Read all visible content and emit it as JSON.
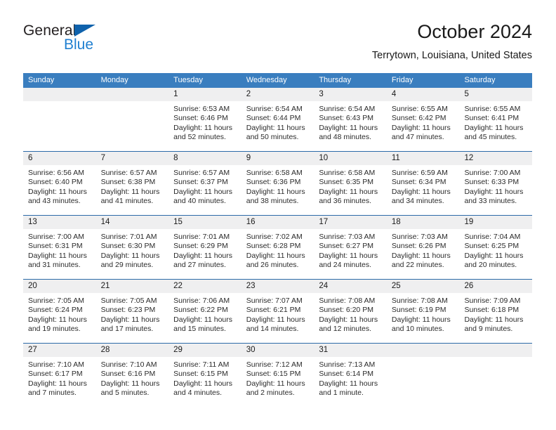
{
  "brand": {
    "name_dark": "General",
    "name_blue": "Blue",
    "accent_blue": "#1f7fd0",
    "triangle_blue": "#0f62ac"
  },
  "header": {
    "title": "October 2024",
    "subtitle": "Terrytown, Louisiana, United States"
  },
  "theme": {
    "header_row_blue": "#3a7ebf",
    "week_separator_blue": "#2c6aa8",
    "day_number_band": "#efeff0"
  },
  "weekday_headers": [
    "Sunday",
    "Monday",
    "Tuesday",
    "Wednesday",
    "Thursday",
    "Friday",
    "Saturday"
  ],
  "weeks": [
    [
      {
        "day": "",
        "sunrise": "",
        "sunset": "",
        "daylight1": "",
        "daylight2": ""
      },
      {
        "day": "",
        "sunrise": "",
        "sunset": "",
        "daylight1": "",
        "daylight2": ""
      },
      {
        "day": "1",
        "sunrise": "Sunrise: 6:53 AM",
        "sunset": "Sunset: 6:46 PM",
        "daylight1": "Daylight: 11 hours",
        "daylight2": "and 52 minutes."
      },
      {
        "day": "2",
        "sunrise": "Sunrise: 6:54 AM",
        "sunset": "Sunset: 6:44 PM",
        "daylight1": "Daylight: 11 hours",
        "daylight2": "and 50 minutes."
      },
      {
        "day": "3",
        "sunrise": "Sunrise: 6:54 AM",
        "sunset": "Sunset: 6:43 PM",
        "daylight1": "Daylight: 11 hours",
        "daylight2": "and 48 minutes."
      },
      {
        "day": "4",
        "sunrise": "Sunrise: 6:55 AM",
        "sunset": "Sunset: 6:42 PM",
        "daylight1": "Daylight: 11 hours",
        "daylight2": "and 47 minutes."
      },
      {
        "day": "5",
        "sunrise": "Sunrise: 6:55 AM",
        "sunset": "Sunset: 6:41 PM",
        "daylight1": "Daylight: 11 hours",
        "daylight2": "and 45 minutes."
      }
    ],
    [
      {
        "day": "6",
        "sunrise": "Sunrise: 6:56 AM",
        "sunset": "Sunset: 6:40 PM",
        "daylight1": "Daylight: 11 hours",
        "daylight2": "and 43 minutes."
      },
      {
        "day": "7",
        "sunrise": "Sunrise: 6:57 AM",
        "sunset": "Sunset: 6:38 PM",
        "daylight1": "Daylight: 11 hours",
        "daylight2": "and 41 minutes."
      },
      {
        "day": "8",
        "sunrise": "Sunrise: 6:57 AM",
        "sunset": "Sunset: 6:37 PM",
        "daylight1": "Daylight: 11 hours",
        "daylight2": "and 40 minutes."
      },
      {
        "day": "9",
        "sunrise": "Sunrise: 6:58 AM",
        "sunset": "Sunset: 6:36 PM",
        "daylight1": "Daylight: 11 hours",
        "daylight2": "and 38 minutes."
      },
      {
        "day": "10",
        "sunrise": "Sunrise: 6:58 AM",
        "sunset": "Sunset: 6:35 PM",
        "daylight1": "Daylight: 11 hours",
        "daylight2": "and 36 minutes."
      },
      {
        "day": "11",
        "sunrise": "Sunrise: 6:59 AM",
        "sunset": "Sunset: 6:34 PM",
        "daylight1": "Daylight: 11 hours",
        "daylight2": "and 34 minutes."
      },
      {
        "day": "12",
        "sunrise": "Sunrise: 7:00 AM",
        "sunset": "Sunset: 6:33 PM",
        "daylight1": "Daylight: 11 hours",
        "daylight2": "and 33 minutes."
      }
    ],
    [
      {
        "day": "13",
        "sunrise": "Sunrise: 7:00 AM",
        "sunset": "Sunset: 6:31 PM",
        "daylight1": "Daylight: 11 hours",
        "daylight2": "and 31 minutes."
      },
      {
        "day": "14",
        "sunrise": "Sunrise: 7:01 AM",
        "sunset": "Sunset: 6:30 PM",
        "daylight1": "Daylight: 11 hours",
        "daylight2": "and 29 minutes."
      },
      {
        "day": "15",
        "sunrise": "Sunrise: 7:01 AM",
        "sunset": "Sunset: 6:29 PM",
        "daylight1": "Daylight: 11 hours",
        "daylight2": "and 27 minutes."
      },
      {
        "day": "16",
        "sunrise": "Sunrise: 7:02 AM",
        "sunset": "Sunset: 6:28 PM",
        "daylight1": "Daylight: 11 hours",
        "daylight2": "and 26 minutes."
      },
      {
        "day": "17",
        "sunrise": "Sunrise: 7:03 AM",
        "sunset": "Sunset: 6:27 PM",
        "daylight1": "Daylight: 11 hours",
        "daylight2": "and 24 minutes."
      },
      {
        "day": "18",
        "sunrise": "Sunrise: 7:03 AM",
        "sunset": "Sunset: 6:26 PM",
        "daylight1": "Daylight: 11 hours",
        "daylight2": "and 22 minutes."
      },
      {
        "day": "19",
        "sunrise": "Sunrise: 7:04 AM",
        "sunset": "Sunset: 6:25 PM",
        "daylight1": "Daylight: 11 hours",
        "daylight2": "and 20 minutes."
      }
    ],
    [
      {
        "day": "20",
        "sunrise": "Sunrise: 7:05 AM",
        "sunset": "Sunset: 6:24 PM",
        "daylight1": "Daylight: 11 hours",
        "daylight2": "and 19 minutes."
      },
      {
        "day": "21",
        "sunrise": "Sunrise: 7:05 AM",
        "sunset": "Sunset: 6:23 PM",
        "daylight1": "Daylight: 11 hours",
        "daylight2": "and 17 minutes."
      },
      {
        "day": "22",
        "sunrise": "Sunrise: 7:06 AM",
        "sunset": "Sunset: 6:22 PM",
        "daylight1": "Daylight: 11 hours",
        "daylight2": "and 15 minutes."
      },
      {
        "day": "23",
        "sunrise": "Sunrise: 7:07 AM",
        "sunset": "Sunset: 6:21 PM",
        "daylight1": "Daylight: 11 hours",
        "daylight2": "and 14 minutes."
      },
      {
        "day": "24",
        "sunrise": "Sunrise: 7:08 AM",
        "sunset": "Sunset: 6:20 PM",
        "daylight1": "Daylight: 11 hours",
        "daylight2": "and 12 minutes."
      },
      {
        "day": "25",
        "sunrise": "Sunrise: 7:08 AM",
        "sunset": "Sunset: 6:19 PM",
        "daylight1": "Daylight: 11 hours",
        "daylight2": "and 10 minutes."
      },
      {
        "day": "26",
        "sunrise": "Sunrise: 7:09 AM",
        "sunset": "Sunset: 6:18 PM",
        "daylight1": "Daylight: 11 hours",
        "daylight2": "and 9 minutes."
      }
    ],
    [
      {
        "day": "27",
        "sunrise": "Sunrise: 7:10 AM",
        "sunset": "Sunset: 6:17 PM",
        "daylight1": "Daylight: 11 hours",
        "daylight2": "and 7 minutes."
      },
      {
        "day": "28",
        "sunrise": "Sunrise: 7:10 AM",
        "sunset": "Sunset: 6:16 PM",
        "daylight1": "Daylight: 11 hours",
        "daylight2": "and 5 minutes."
      },
      {
        "day": "29",
        "sunrise": "Sunrise: 7:11 AM",
        "sunset": "Sunset: 6:15 PM",
        "daylight1": "Daylight: 11 hours",
        "daylight2": "and 4 minutes."
      },
      {
        "day": "30",
        "sunrise": "Sunrise: 7:12 AM",
        "sunset": "Sunset: 6:15 PM",
        "daylight1": "Daylight: 11 hours",
        "daylight2": "and 2 minutes."
      },
      {
        "day": "31",
        "sunrise": "Sunrise: 7:13 AM",
        "sunset": "Sunset: 6:14 PM",
        "daylight1": "Daylight: 11 hours",
        "daylight2": "and 1 minute."
      },
      {
        "day": "",
        "sunrise": "",
        "sunset": "",
        "daylight1": "",
        "daylight2": ""
      },
      {
        "day": "",
        "sunrise": "",
        "sunset": "",
        "daylight1": "",
        "daylight2": ""
      }
    ]
  ]
}
